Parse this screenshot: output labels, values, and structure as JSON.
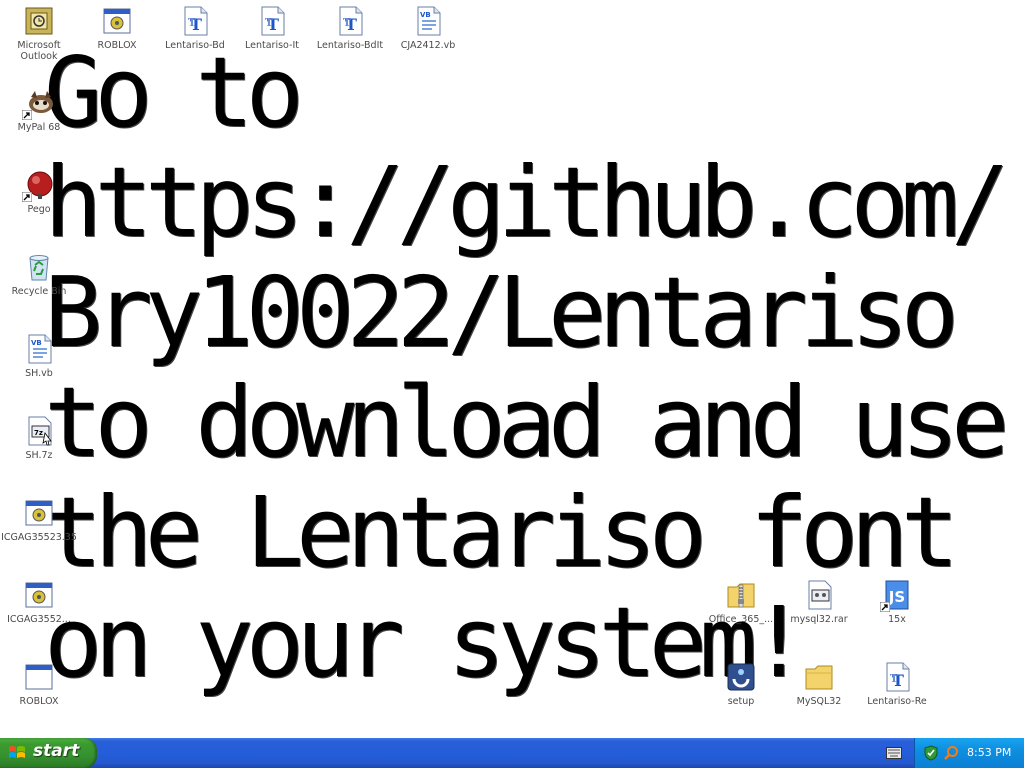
{
  "wallpaper": {
    "text": "Go to https://github.com/ Bry10022/Lentariso to download and use the Lentariso font on your system!"
  },
  "desktop_icons": {
    "outlook": "Microsoft Outlook",
    "roblox_top": "ROBLOX",
    "lentariso_bd": "Lentariso-Bd",
    "lentariso_it": "Lentariso-It",
    "lentariso_bdit": "Lentariso-BdIt",
    "cja_vb": "CJA2412.vb",
    "mypal": "MyPal 68",
    "pego": "Pego",
    "recycle_bin": "Recycle Bin",
    "sh_vb": "SH.vb",
    "sh_7z": "SH.7z",
    "icgag_1": "ICGAG35523.35",
    "icgag_2": "ICGAG3552...",
    "roblox_bottom": "ROBLOX",
    "office_365": "Office_365_...",
    "mysql_rar": "mysql32.rar",
    "js_file": "15x",
    "setup": "setup",
    "mysql_folder": "MySQL32",
    "lentariso_re": "Lentariso-Re"
  },
  "icon_names": [
    "outlook-icon",
    "application-icon",
    "truetype-font-icon",
    "vbscript-file-icon",
    "mypal-browser-icon",
    "pego-icon",
    "recycle-bin-icon",
    "7z-archive-icon",
    "zip-folder-icon",
    "rar-archive-icon",
    "jscript-file-icon",
    "setup-icon",
    "folder-icon"
  ],
  "taskbar": {
    "start_label": "start",
    "clock": "8:53 PM"
  },
  "colors": {
    "taskbar_blue": "#245edb",
    "start_green": "#3b9b2f",
    "tray_blue": "#0f8ee0"
  }
}
